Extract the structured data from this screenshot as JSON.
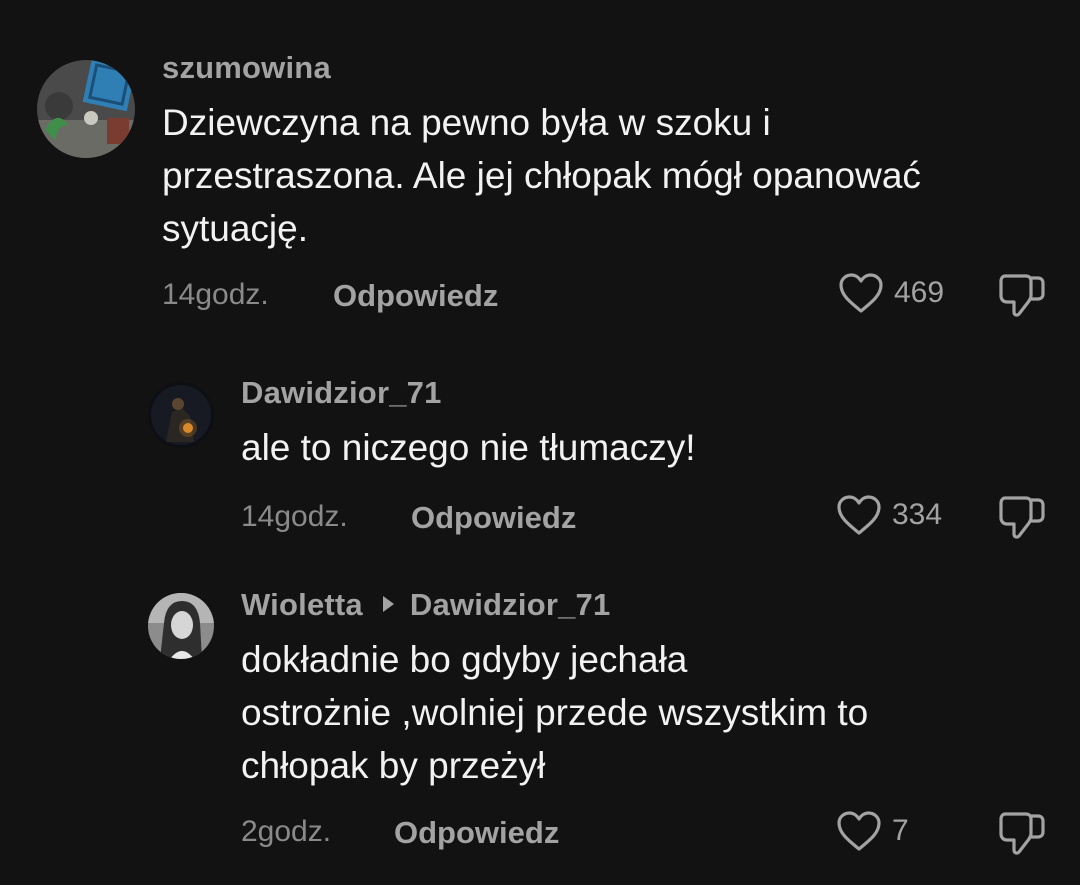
{
  "comments": [
    {
      "username": "szumowina",
      "lines": [
        "Dziewczyna na pewno była w szoku i",
        "przestraszona. Ale jej chłopak mógł opanować",
        "sytuację."
      ],
      "time": "14godz.",
      "reply_label": "Odpowiedz",
      "likes": "469"
    },
    {
      "username": "Dawidzior_71",
      "lines": [
        "ale to niczego nie tłumaczy!"
      ],
      "time": "14godz.",
      "reply_label": "Odpowiedz",
      "likes": "334"
    },
    {
      "username": "Wioletta",
      "reply_to": "Dawidzior_71",
      "lines": [
        "dokładnie bo gdyby jechała",
        "ostrożnie ,wolniej przede wszystkim to",
        "chłopak by przeżył"
      ],
      "time": "2godz.",
      "reply_label": "Odpowiedz",
      "likes": "7"
    }
  ],
  "icons": {
    "like": "heart-outline-icon",
    "dislike": "thumbs-down-outline-icon",
    "reply_indicator": "triangle-right-icon"
  },
  "colors": {
    "background": "#121212",
    "text": "#f2f2f2",
    "muted": "#a3a3a3"
  }
}
